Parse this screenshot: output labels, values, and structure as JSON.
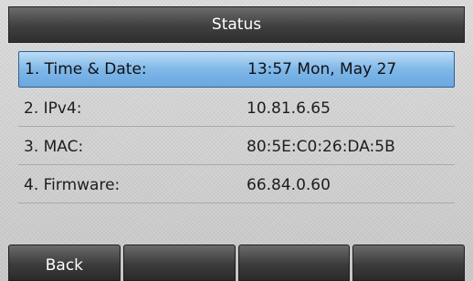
{
  "header": {
    "title": "Status"
  },
  "items": [
    {
      "label": "1. Time & Date:",
      "value": "13:57 Mon, May 27",
      "selected": true
    },
    {
      "label": "2. IPv4:",
      "value": "10.81.6.65"
    },
    {
      "label": "3. MAC:",
      "value": "80:5E:C0:26:DA:5B"
    },
    {
      "label": "4. Firmware:",
      "value": "66.84.0.60"
    }
  ],
  "softkeys": [
    "Back",
    "",
    "",
    ""
  ],
  "colors": {
    "selection": "#7fb7e8",
    "titlebar": "#3f3f3f"
  }
}
